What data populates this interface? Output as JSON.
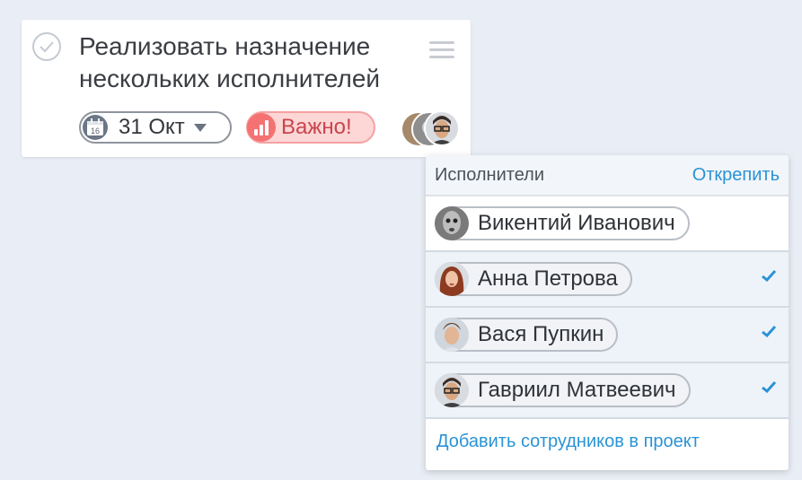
{
  "task": {
    "title": "Реализовать назначение нескольких исполнителей",
    "due_date": "31 Окт",
    "calendar_day": "16",
    "priority_label": "Важно!"
  },
  "assignees_panel": {
    "title": "Исполнители",
    "unpin_label": "Открепить",
    "add_link": "Добавить сотрудников в проект",
    "people": [
      {
        "name": "Викентий Иванович",
        "selected": false
      },
      {
        "name": "Анна Петрова",
        "selected": true
      },
      {
        "name": "Вася Пупкин",
        "selected": true
      },
      {
        "name": "Гавриил Матвеевич",
        "selected": true
      }
    ]
  },
  "colors": {
    "background": "#e9eef6",
    "accent_blue": "#2a93d5",
    "priority_red": "#f47272",
    "selected_row": "#eef3f9"
  }
}
